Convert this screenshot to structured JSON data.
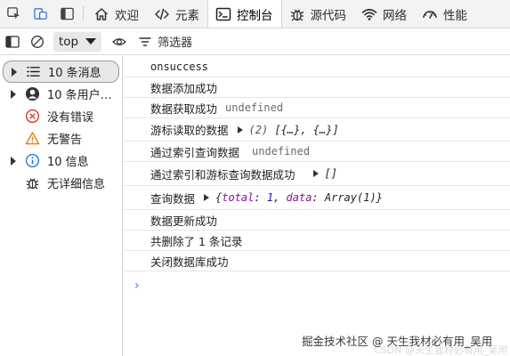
{
  "tabs": [
    {
      "label": "欢迎",
      "icon": "home-icon"
    },
    {
      "label": "元素",
      "icon": "code-icon"
    },
    {
      "label": "控制台",
      "icon": "console-icon",
      "active": true
    },
    {
      "label": "源代码",
      "icon": "bug-icon"
    },
    {
      "label": "网络",
      "icon": "wifi-icon"
    },
    {
      "label": "性能",
      "icon": "performance-icon"
    }
  ],
  "toolbar": {
    "context": "top",
    "filter_placeholder": "筛选器"
  },
  "sidebar": {
    "items": [
      {
        "label": "10 条消息",
        "icon": "list-icon",
        "expandable": true,
        "selected": true
      },
      {
        "label": "10 条用户…",
        "icon": "user-icon",
        "expandable": true
      },
      {
        "label": "没有错误",
        "icon": "error-icon",
        "expandable": false
      },
      {
        "label": "无警告",
        "icon": "warning-icon",
        "expandable": false
      },
      {
        "label": "10 信息",
        "icon": "info-icon",
        "expandable": true
      },
      {
        "label": "无详细信息",
        "icon": "verbose-icon",
        "expandable": false
      }
    ]
  },
  "console": {
    "logs": [
      {
        "text": "onsuccess"
      },
      {
        "text": "数据添加成功"
      },
      {
        "text": "数据获取成功",
        "value": "undefined"
      },
      {
        "text": "游标读取的数据",
        "object": {
          "count": "(2)",
          "body": "[{…}, {…}]"
        }
      },
      {
        "text": "通过索引查询数据",
        "value": "undefined"
      },
      {
        "text": "通过索引和游标查询数据成功",
        "object": {
          "body": "[]"
        }
      },
      {
        "text": "查询数据",
        "object": {
          "total_key": "total",
          "total_value": "1",
          "data_key": "data",
          "data_value": "Array(1)"
        }
      },
      {
        "text": "数据更新成功"
      },
      {
        "text": "共删除了 1 条记录"
      },
      {
        "text": "关闭数据库成功"
      }
    ]
  },
  "watermark": "掘金技术社区 @ 天生我材必有用_吴用",
  "watermark_faint": "CSDN @天生我材必有用_吴用"
}
